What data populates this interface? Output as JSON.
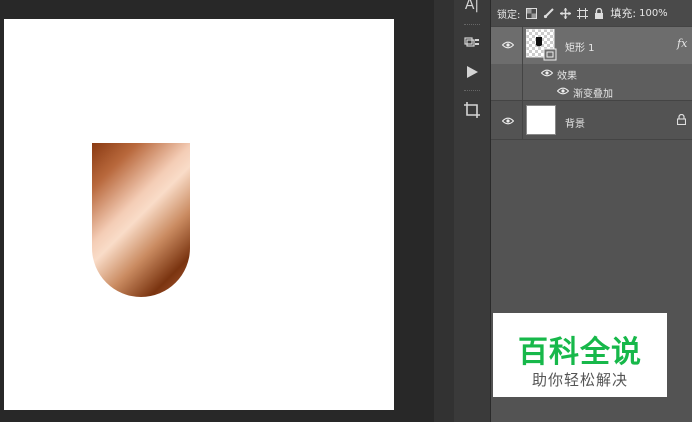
{
  "toolbar": {
    "items": [
      {
        "name": "type-tool",
        "label": "A|"
      },
      {
        "name": "3d-tool",
        "icon": "cube-grid-icon"
      },
      {
        "name": "play-action",
        "icon": "play-icon"
      },
      {
        "name": "crop-tool",
        "icon": "crop-icon"
      }
    ]
  },
  "layers_panel": {
    "lock_label": "锁定:",
    "fill_label": "填充:",
    "fill_value": "100%",
    "layers": [
      {
        "name": "矩形 1",
        "fx": "fx",
        "effects_label": "效果",
        "effects": [
          "渐变叠加"
        ]
      },
      {
        "name": "背景"
      }
    ]
  },
  "watermark": {
    "title": "百科全说",
    "subtitle": "助你轻松解决"
  },
  "colors": {
    "canvas_bg": "#ffffff",
    "workspace_bg": "#282828",
    "panel_bg": "#535353",
    "selected_layer": "#6d6d6d",
    "watermark_green": "#17b84a",
    "gradient_dark": "#8a3a12",
    "gradient_light": "#f9dcc8"
  }
}
